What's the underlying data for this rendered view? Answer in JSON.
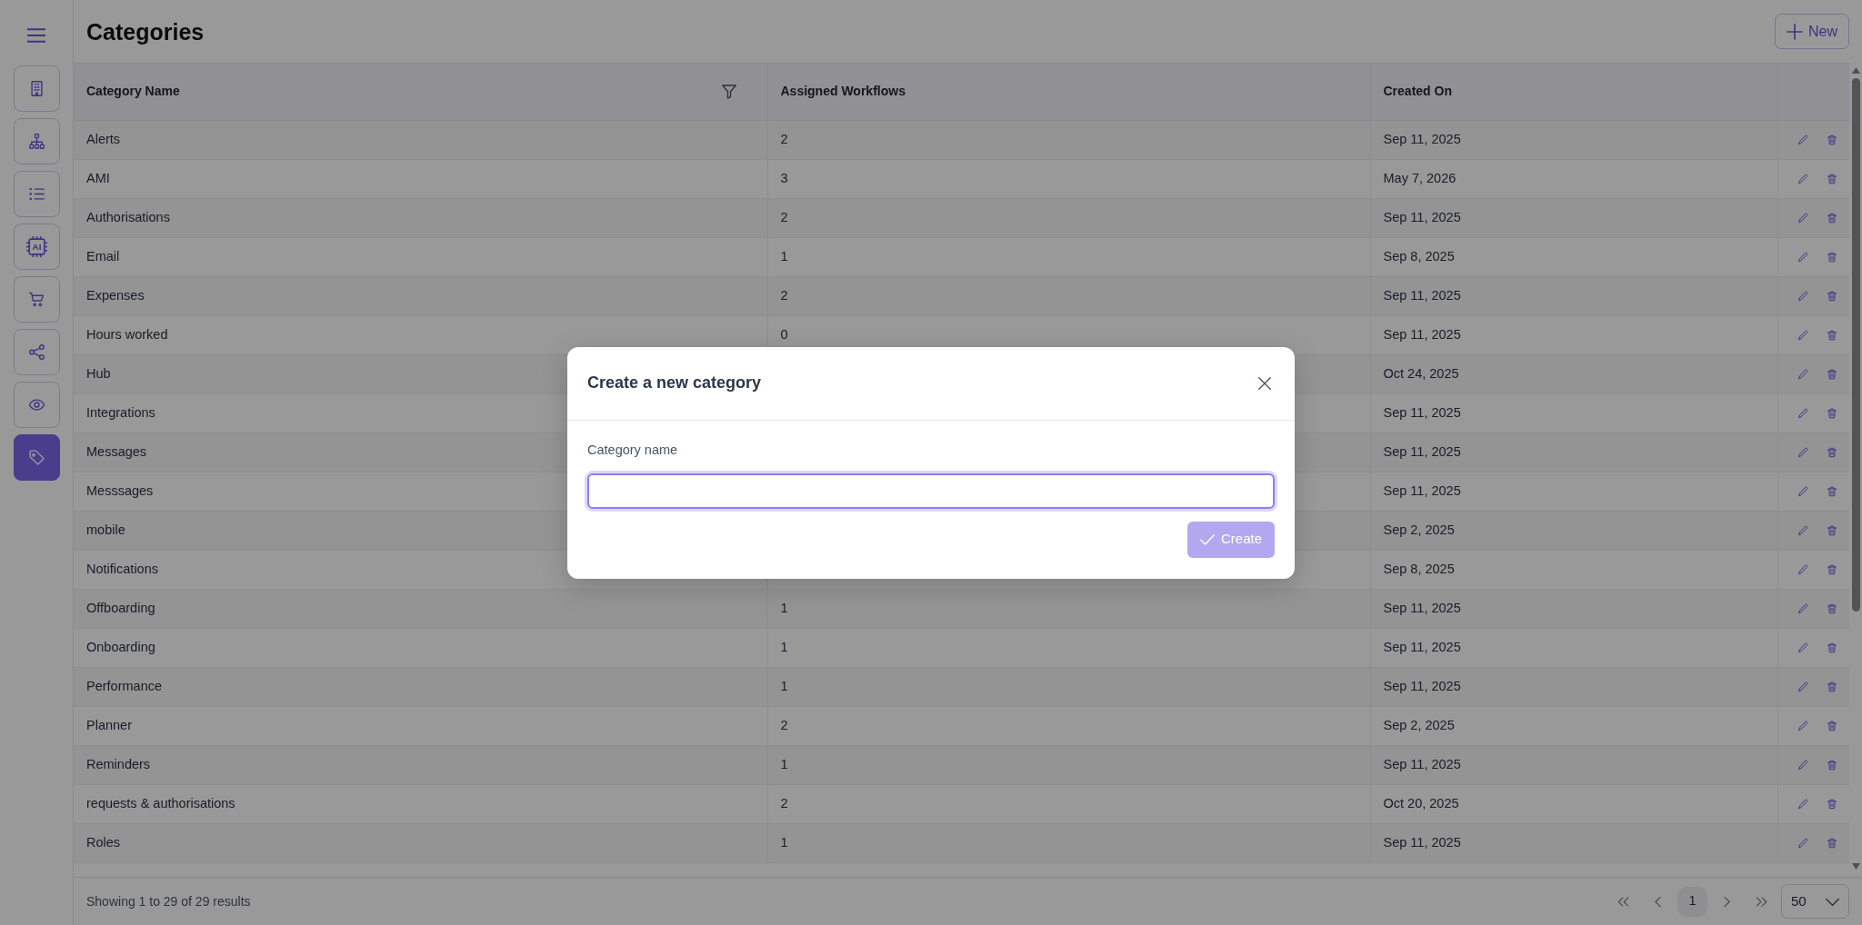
{
  "sidebar": {
    "items": [
      {
        "selected": false
      },
      {
        "selected": false
      },
      {
        "selected": false
      },
      {
        "selected": false,
        "icon_text": "AI"
      },
      {
        "selected": false
      },
      {
        "selected": false
      },
      {
        "selected": false
      },
      {
        "selected": true
      }
    ]
  },
  "header": {
    "title": "Categories",
    "new_button": "New"
  },
  "table": {
    "columns": [
      {
        "label": "Category Name",
        "filter": true
      },
      {
        "label": "Assigned Workflows",
        "filter": false
      },
      {
        "label": "Created On",
        "filter": false
      }
    ],
    "rows": [
      {
        "name": "Alerts",
        "workflows": "2",
        "created": "Sep 11, 2025"
      },
      {
        "name": "AMI",
        "workflows": "3",
        "created": "May 7, 2026"
      },
      {
        "name": "Authorisations",
        "workflows": "2",
        "created": "Sep 11, 2025"
      },
      {
        "name": "Email",
        "workflows": "1",
        "created": "Sep 8, 2025"
      },
      {
        "name": "Expenses",
        "workflows": "2",
        "created": "Sep 11, 2025"
      },
      {
        "name": "Hours worked",
        "workflows": "0",
        "created": "Sep 11, 2025"
      },
      {
        "name": "Hub",
        "created": "Oct 24, 2025"
      },
      {
        "name": "Integrations",
        "created": "Sep 11, 2025"
      },
      {
        "name": "Messages",
        "created": "Sep 11, 2025"
      },
      {
        "name": "Messsages",
        "created": "Sep 11, 2025"
      },
      {
        "name": "mobile",
        "created": "Sep 2, 2025"
      },
      {
        "name": "Notifications",
        "created": "Sep 8, 2025"
      },
      {
        "name": "Offboarding",
        "workflows": "1",
        "created": "Sep 11, 2025"
      },
      {
        "name": "Onboarding",
        "workflows": "1",
        "created": "Sep 11, 2025"
      },
      {
        "name": "Performance",
        "workflows": "1",
        "created": "Sep 11, 2025"
      },
      {
        "name": "Planner",
        "workflows": "2",
        "created": "Sep 2, 2025"
      },
      {
        "name": "Reminders",
        "workflows": "1",
        "created": "Sep 11, 2025"
      },
      {
        "name": "requests & authorisations",
        "workflows": "2",
        "created": "Oct 20, 2025"
      },
      {
        "name": "Roles",
        "workflows": "1",
        "created": "Sep 11, 2025"
      }
    ]
  },
  "footer": {
    "summary": "Showing 1 to 29 of 29 results",
    "pages": [
      {
        "label": "1",
        "selected": true
      }
    ],
    "page_size": "50"
  },
  "modal": {
    "title": "Create a new category",
    "field_label": "Category name",
    "create_button": "Create",
    "create_disabled": true
  }
}
